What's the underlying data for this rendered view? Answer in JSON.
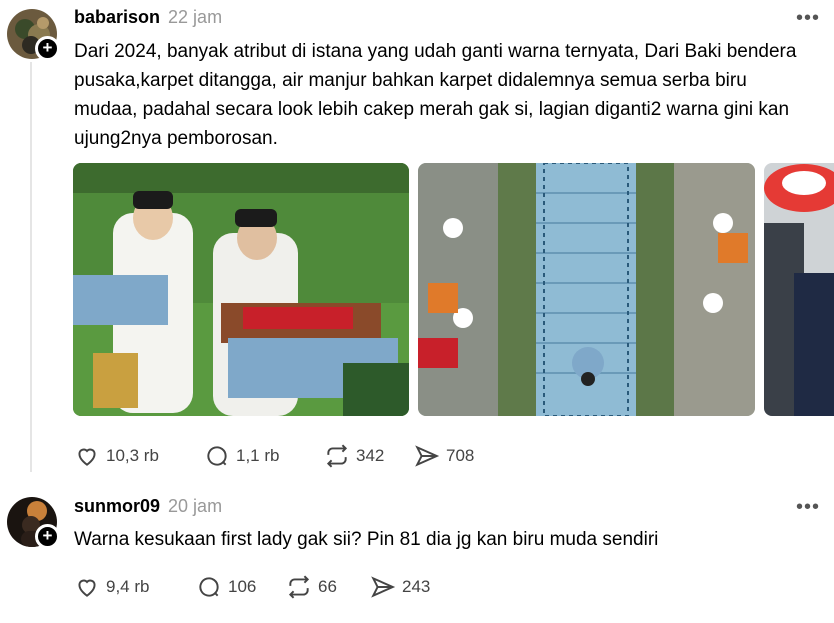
{
  "posts": [
    {
      "username": "babarison",
      "timestamp": "22 jam",
      "text": "Dari 2024, banyak atribut di istana yang udah ganti warna ternyata, Dari Baki bendera pusaka,karpet ditangga, air manjur bahkan karpet didalemnya semua serba biru mudaa, padahal secara look lebih cakep merah gak si, lagian diganti2 warna gini kan ujung2nya pemborosan.",
      "more_label": "•••",
      "actions": {
        "likes": "10,3 rb",
        "replies": "1,1 rb",
        "reposts": "342",
        "shares": "708"
      }
    },
    {
      "username": "sunmor09",
      "timestamp": "20 jam",
      "text": "Warna kesukaan first lady gak sii? Pin 81 dia jg kan biru muda sendiri",
      "more_label": "•••",
      "actions": {
        "likes": "9,4 rb",
        "replies": "106",
        "reposts": "66",
        "shares": "243"
      }
    }
  ],
  "icons": {
    "follow": "plus-icon",
    "like": "heart-icon",
    "reply": "comment-icon",
    "repost": "repost-icon",
    "share": "send-icon"
  },
  "colors": {
    "text": "#000000",
    "muted": "#999999",
    "thread_line": "#e5e5e5"
  },
  "plus_label": "+"
}
